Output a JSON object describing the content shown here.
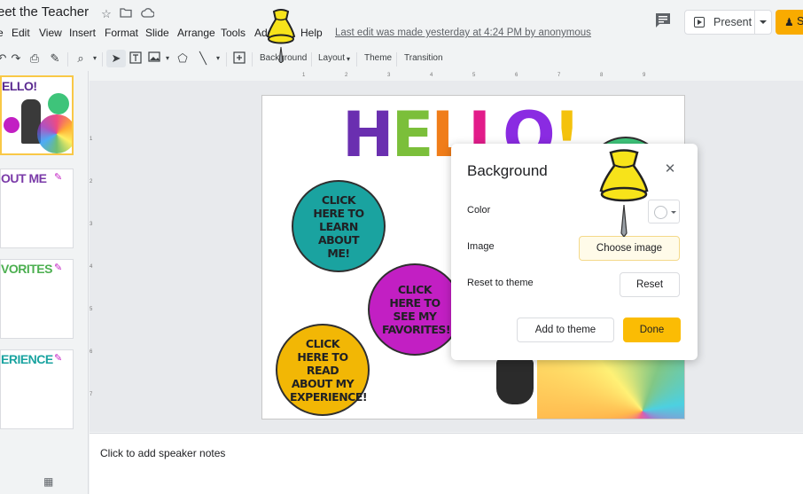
{
  "app": {
    "doc_title": "eet the Teacher",
    "last_edit": "Last edit was made yesterday at 4:24 PM by anonymous",
    "present_label": "Present",
    "share_label": "S"
  },
  "menu": [
    "Edit",
    "View",
    "Insert",
    "Format",
    "Slide",
    "Arrange",
    "Tools",
    "Add-ons",
    "Help"
  ],
  "menu_first": "e",
  "toolbar": {
    "background": "Background",
    "layout": "Layout",
    "theme": "Theme",
    "transition": "Transition"
  },
  "ruler": {
    "h": [
      "1",
      "2",
      "3",
      "4",
      "5",
      "6",
      "7",
      "8",
      "9"
    ],
    "v": [
      "1",
      "2",
      "3",
      "4",
      "5",
      "6",
      "7"
    ]
  },
  "filmstrip": [
    {
      "text": "ELLO!",
      "color": "#5a2a90"
    },
    {
      "text": "OUT ME",
      "color": "#7a3aa8"
    },
    {
      "text": "VORITES",
      "color": "#4caf50"
    },
    {
      "text": "ERIENCE",
      "color": "#1aa3a0"
    }
  ],
  "slide": {
    "hello": [
      "H",
      "E",
      "L",
      "L",
      "O",
      "!"
    ],
    "hello_colors": [
      "#6a2fb0",
      "#7bbf3a",
      "#f07d1a",
      "#e21c8a",
      "#8a2be2",
      "#f4c20d"
    ],
    "circles": [
      {
        "text": "CLICK HERE TO LEARN ABOUT ME!",
        "color": "#1aa3a0"
      },
      {
        "text": "CLICK HERE TO SEE MY FAVORITES!",
        "color": "#c21fc3"
      },
      {
        "text": "CLICK HERE TO READ ABOUT MY EXPERIENCE!",
        "color": "#f2b705"
      }
    ]
  },
  "notes_placeholder": "Click to add speaker notes",
  "dialog": {
    "title": "Background",
    "color_label": "Color",
    "image_label": "Image",
    "reset_label": "Reset to theme",
    "choose_image": "Choose image",
    "reset": "Reset",
    "add_to_theme": "Add to theme",
    "done": "Done"
  },
  "colors": {
    "accent": "#fbbc04",
    "pin": "#f7e31a"
  }
}
